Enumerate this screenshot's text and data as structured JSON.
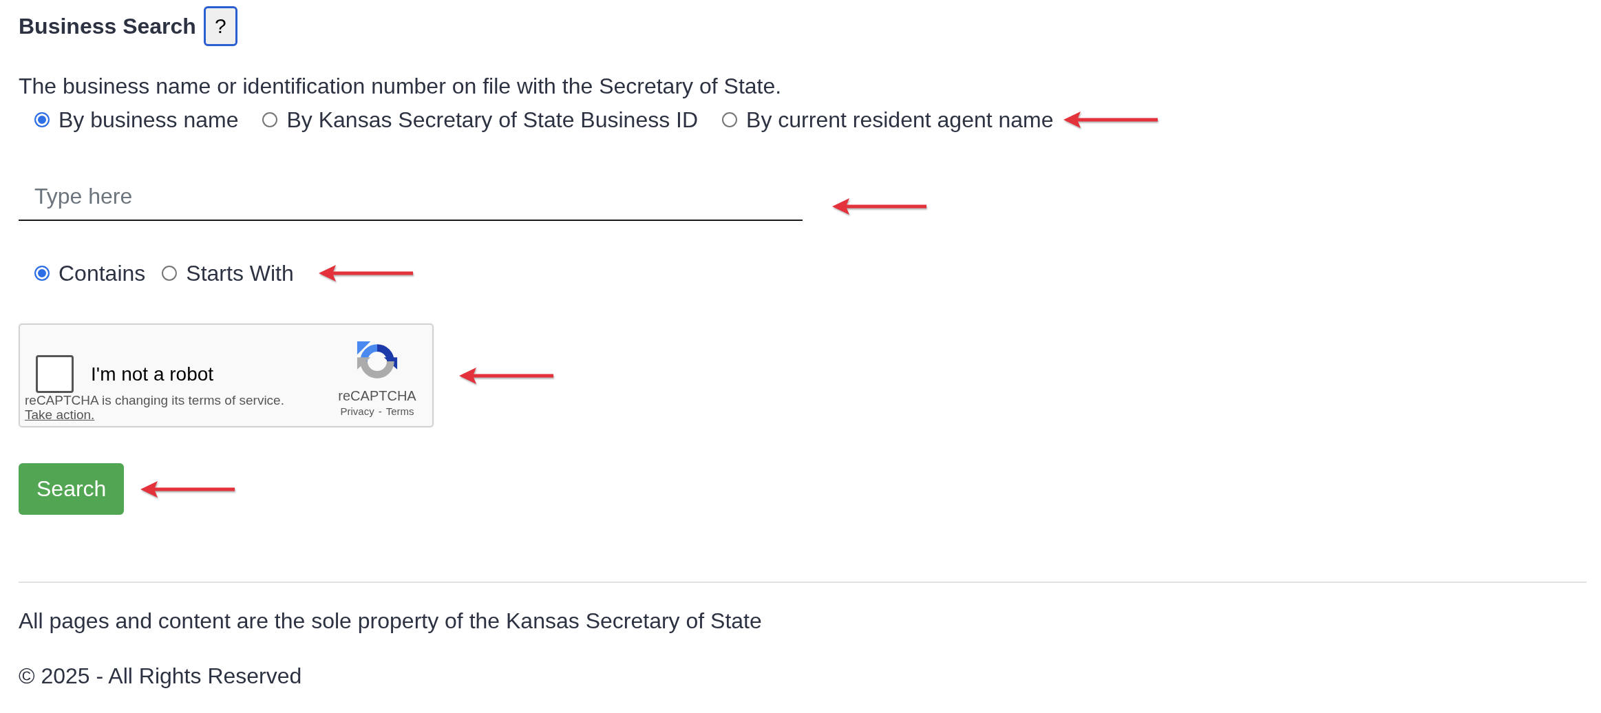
{
  "heading": {
    "title": "Business Search",
    "help_button": "?"
  },
  "description": "The business name or identification number on file with the Secretary of State.",
  "search_by": {
    "options": [
      {
        "label": "By business name",
        "selected": true
      },
      {
        "label": "By Kansas Secretary of State Business ID",
        "selected": false
      },
      {
        "label": "By current resident agent name",
        "selected": false
      }
    ],
    "arrow": true
  },
  "search_field": {
    "placeholder": "Type here",
    "arrow": true
  },
  "match_mode": {
    "options": [
      {
        "label": "Contains",
        "selected": true
      },
      {
        "label": "Starts With",
        "selected": false
      }
    ],
    "arrow": true
  },
  "captcha": {
    "label": "I'm not a robot",
    "checked": false,
    "notice": "reCAPTCHA is changing its terms of service.",
    "notice_link": "Take action.",
    "brand": "reCAPTCHA",
    "links": [
      "Privacy",
      "Terms"
    ],
    "separator": "-",
    "arrow": true
  },
  "search_button": {
    "label": "Search",
    "arrow": true
  },
  "footer": {
    "lines": [
      "All pages and content are the sole property of the Kansas Secretary of State",
      "© 2025 - All Rights Reserved"
    ]
  }
}
